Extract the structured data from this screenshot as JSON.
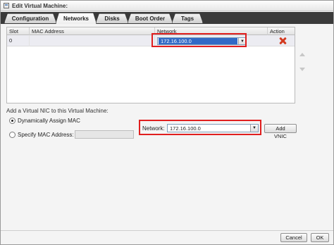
{
  "window": {
    "title": "Edit Virtual Machine:"
  },
  "tabs": [
    {
      "label": "Configuration",
      "active": false
    },
    {
      "label": "Networks",
      "active": true
    },
    {
      "label": "Disks",
      "active": false
    },
    {
      "label": "Boot Order",
      "active": false
    },
    {
      "label": "Tags",
      "active": false
    }
  ],
  "nic_table": {
    "columns": [
      "Slot",
      "MAC Address",
      "Network",
      "Action"
    ],
    "rows": [
      {
        "slot": "0",
        "mac": "",
        "network": "172.16.100.0",
        "action_icon": "delete-x-icon"
      }
    ]
  },
  "add_section": {
    "heading": "Add a Virtual NIC to this Virtual Machine:",
    "option_dynamic": "Dynamically Assign MAC",
    "option_specify": "Specify MAC Address:",
    "mac_value": "",
    "network_label": "Network:",
    "network_value": "172.16.100.0",
    "add_button": "Add VNIC"
  },
  "footer": {
    "cancel_button": "Cancel",
    "ok_button": "OK"
  },
  "colors": {
    "highlight": "#e01f1f",
    "selection": "#3169c6",
    "tab_strip": "#3a3a3a"
  }
}
